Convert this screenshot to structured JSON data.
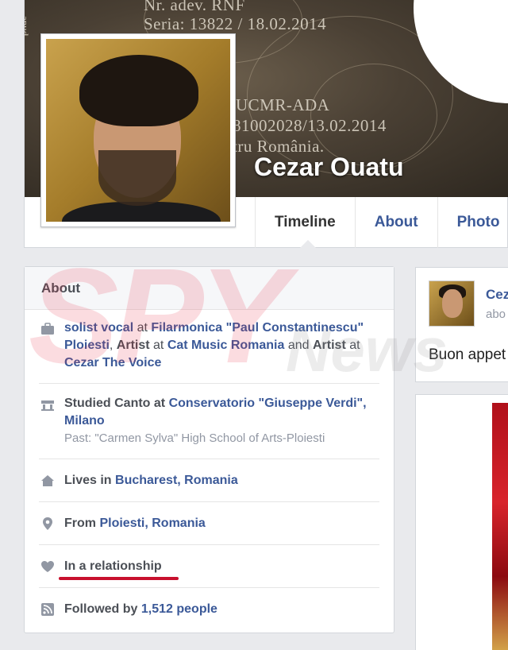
{
  "cover": {
    "line1": "Nr. adev. RNF",
    "line2": "Seria: 13822 / 18.02.2014",
    "line3": "UCMR-ADA",
    "line4": "81002028/13.02.2014",
    "line5": "tru România.",
    "vert": "anud"
  },
  "profile": {
    "name": "Cezar Ouatu"
  },
  "tabs": [
    "Timeline",
    "About",
    "Photo"
  ],
  "about": {
    "title": "About",
    "work": {
      "role1": "solist vocal",
      "at1": " at ",
      "org1": "Filarmonica \"Paul Constantinescu\" Ploiesti",
      "sep1": ", ",
      "role2": "Artist",
      "at2": " at ",
      "org2": "Cat Music Romania",
      "and": " and ",
      "role3": "Artist",
      "at3": " at ",
      "org3": "Cezar The Voice"
    },
    "education": {
      "prefix": "Studied Canto at ",
      "school": "Conservatorio \"Giuseppe Verdi\", Milano",
      "past": "Past: \"Carmen Sylva\" High School of Arts-Ploiesti"
    },
    "lives": {
      "prefix": "Lives in ",
      "place": "Bucharest, Romania"
    },
    "from": {
      "prefix": "From ",
      "place": "Ploiesti, Romania"
    },
    "relationship": "In a relationship",
    "followers": {
      "prefix": "Followed by ",
      "count": "1,512 people"
    }
  },
  "post": {
    "name": "Cezar",
    "sub": "abo",
    "text": "Buon appet"
  },
  "watermark": {
    "main": "SPY",
    "news": "News"
  },
  "icons": {
    "work": "briefcase-icon",
    "education": "graduation-icon",
    "home": "home-icon",
    "pin": "pin-icon",
    "heart": "heart-icon",
    "rss": "rss-icon"
  },
  "colors": {
    "link": "#3b5998",
    "highlight": "#c8102e",
    "background": "#e9eaed"
  }
}
